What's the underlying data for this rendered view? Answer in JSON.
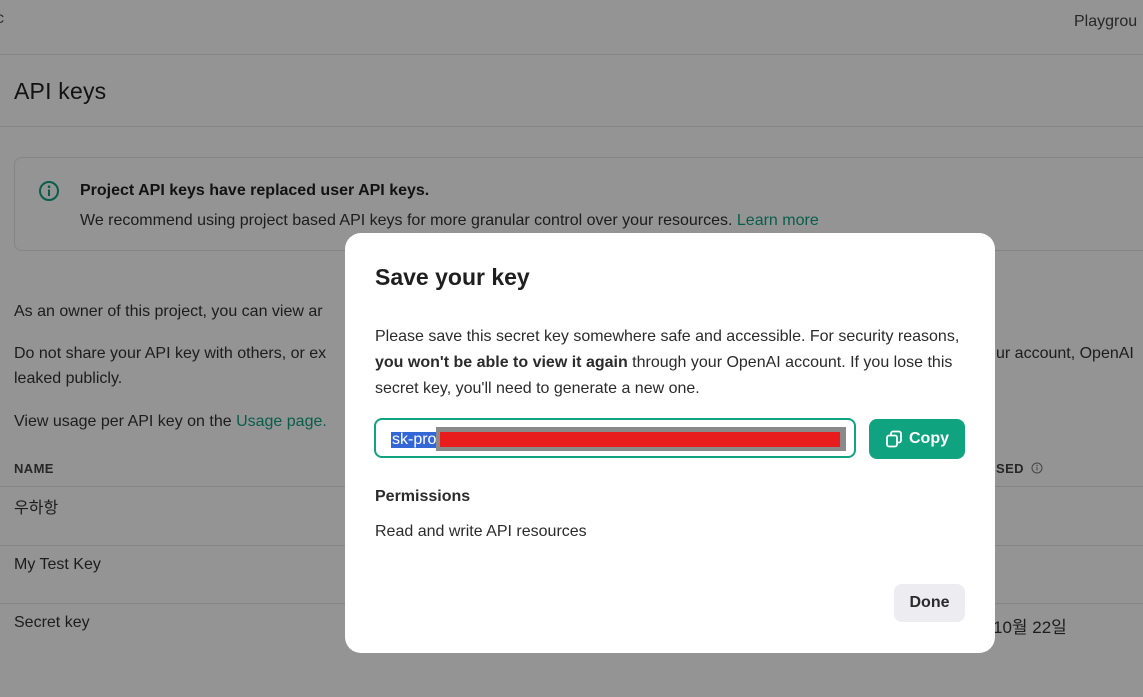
{
  "topbar": {
    "left_mark": "c",
    "playground_label": "Playgrou"
  },
  "page_title": "API keys",
  "banner": {
    "title": "Project API keys have replaced user API keys.",
    "text": "We recommend using project based API keys for more granular control over your resources.",
    "link": "Learn more"
  },
  "paragraphs": {
    "owner_text": "As an owner of this project, you can view ar",
    "share_text_left": "Do not share your API key with others, or ex",
    "share_text_right": "ur account, OpenAI",
    "share_text_line2": "leaked publicly.",
    "usage_prefix": "View usage per API key on the",
    "usage_link": "Usage page."
  },
  "table": {
    "columns": {
      "name": "NAME",
      "last_used": "SED"
    },
    "rows": [
      {
        "name": "우하항",
        "last_used": ""
      },
      {
        "name": "My Test Key",
        "last_used": ""
      },
      {
        "name": "Secret key",
        "last_used": "10월 22일"
      }
    ]
  },
  "modal": {
    "title": "Save your key",
    "desc_part1": "Please save this secret key somewhere safe and accessible. For security reasons, ",
    "desc_bold": "you won't be able to view it again",
    "desc_part2": " through your OpenAI account. If you lose this secret key, you'll need to generate a new one.",
    "key_visible": "sk-pro",
    "copy_label": "Copy",
    "permissions_title": "Permissions",
    "permissions_text": "Read and write API resources",
    "done_label": "Done"
  },
  "colors": {
    "accent": "#10a37f",
    "selection": "#3367d6",
    "redaction": "#e81c1c"
  },
  "icons": [
    "info-icon",
    "copy-icon",
    "info-small-icon"
  ]
}
